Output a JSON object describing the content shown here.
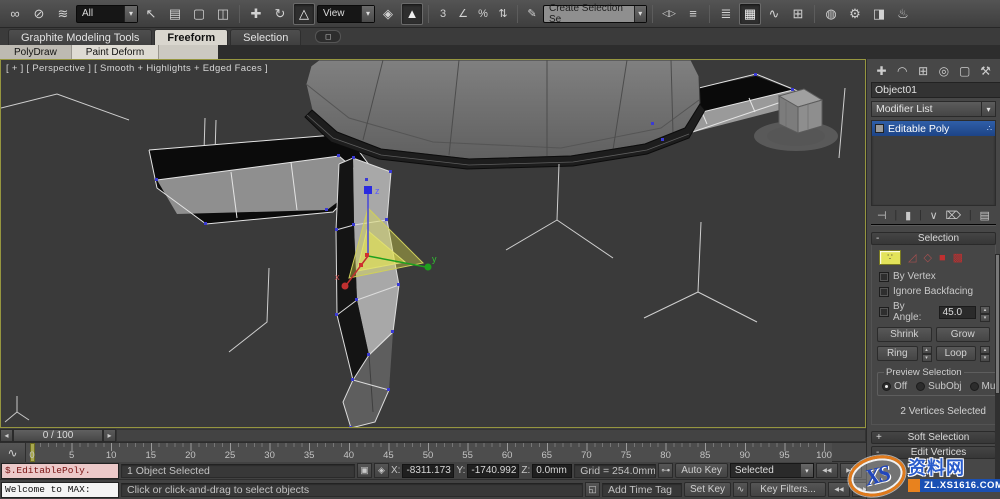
{
  "icons": {
    "link": "∞",
    "unlink": "⊘",
    "bind_spacewarp": "≋",
    "cursor": "↖",
    "by_name": "▤",
    "region": "▢",
    "window_crossing": "◫",
    "move": "✚",
    "rotate": "↻",
    "scale": "△",
    "manipulate": "◈",
    "kbd_override": "▲",
    "snap3": "3",
    "snap_angle": "∠",
    "snap_percent": "%",
    "snap_spinner": "⇅",
    "named_sets": "✎",
    "mirror": "◁▷",
    "align": "≡",
    "layers": "≣",
    "toolbox": "▦",
    "curve_editor": "∿",
    "schematic": "⊞",
    "material": "◍",
    "render_setup": "⚙",
    "render_frame": "◨",
    "render": "♨",
    "tab_create": "✚",
    "tab_modify": "◠",
    "tab_hierarchy": "⊞",
    "tab_motion": "◎",
    "tab_display": "▢",
    "tab_utilities": "⚒",
    "pin": "⊣",
    "end_result": "▮",
    "make_unique": "∨",
    "remove": "⌦",
    "configure": "▤",
    "chevron_down": "▾",
    "spin_up": "▴",
    "spin_down": "▾",
    "dots": "∴",
    "ribbon_min": "◻",
    "arrow_left": "◂",
    "arrow_right": "▸",
    "prev_key": "◀◀",
    "next_key": "▶▶",
    "lock": "▣",
    "abs_offset": "◈",
    "key": "⊶",
    "isolate": "◱",
    "key_tangent": "∿",
    "subobj_vertex": "∵",
    "subobj_edge": "◿",
    "subobj_border": "◇",
    "subobj_poly": "■",
    "subobj_element": "▩",
    "plus": "+",
    "minus": "-"
  },
  "toolbar": {
    "all_dropdown": "All",
    "view_dropdown": "View",
    "selection_set_dropdown": "Create Selection Se"
  },
  "ribbon": {
    "tab_graphite": "Graphite Modeling Tools",
    "tab_freeform": "Freeform",
    "tab_selection": "Selection",
    "subtab_polydraw": "PolyDraw",
    "subtab_paintdeform": "Paint Deform"
  },
  "viewport": {
    "label": "[ + ] [ Perspective ] [ Smooth + Highlights + Edged Faces ]",
    "axis_x": "x",
    "axis_y": "y",
    "axis_z": "z"
  },
  "panel": {
    "object_name": "Object01",
    "modifier_list": "Modifier List",
    "stack_item": "Editable Poly",
    "selection": {
      "title": "Selection",
      "by_vertex": "By Vertex",
      "ignore_backfacing": "Ignore Backfacing",
      "by_angle": "By Angle:",
      "angle_value": "45.0",
      "shrink": "Shrink",
      "grow": "Grow",
      "ring": "Ring",
      "loop": "Loop",
      "preview": "Preview Selection",
      "off": "Off",
      "subobj": "SubObj",
      "multi": "Multi",
      "status": "2 Vertices Selected"
    },
    "soft_selection": "Soft Selection",
    "edit_vertices": "Edit Vertices"
  },
  "timeline": {
    "slider_value": "0 / 100",
    "ticks": [
      "0",
      "5",
      "10",
      "15",
      "20",
      "25",
      "30",
      "35",
      "40",
      "45",
      "50",
      "55",
      "60",
      "65",
      "70",
      "75",
      "80",
      "85",
      "90",
      "95",
      "100"
    ]
  },
  "statusbar": {
    "listener_line1": "$.EditablePoly.",
    "listener_line2": "Welcome to MAX:",
    "selected": "1 Object Selected",
    "prompt": "Click or click-and-drag to select objects",
    "x_label": "X:",
    "x_value": "-8311.173",
    "y_label": "Y:",
    "y_value": "-1740.992",
    "z_label": "Z:",
    "z_value": "0.0mm",
    "grid": "Grid = 254.0mm",
    "add_time_tag": "Add Time Tag",
    "auto_key": "Auto Key",
    "set_key": "Set Key",
    "selected_filter": "Selected",
    "key_filters": "Key Filters..."
  },
  "watermark": {
    "xs": "XS",
    "cn": "资料网",
    "url": "ZL.XS1616.COM"
  }
}
